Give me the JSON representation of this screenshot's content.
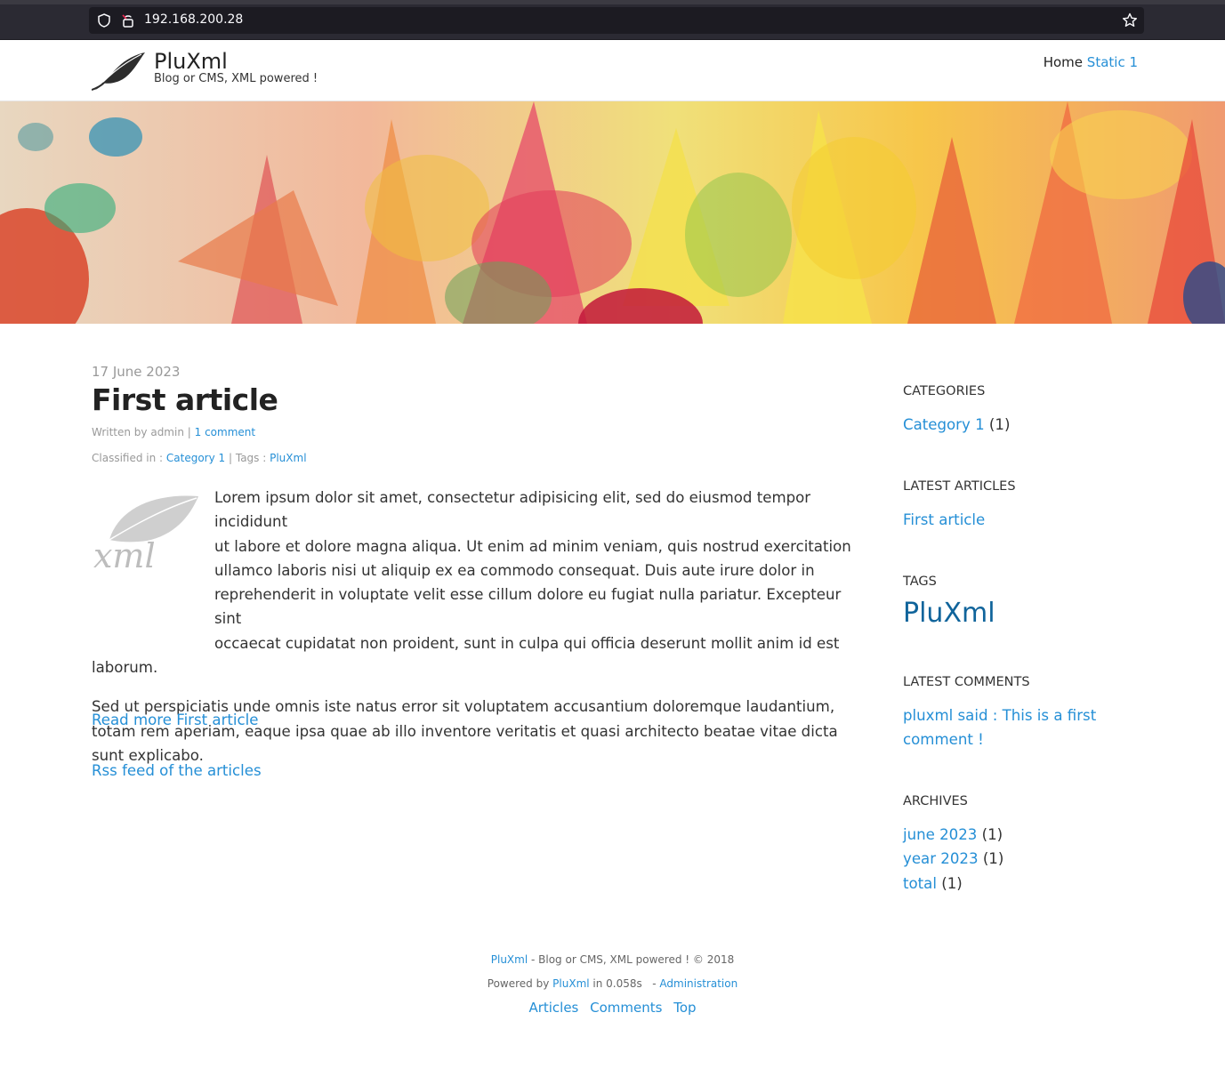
{
  "browser": {
    "url": "192.168.200.28"
  },
  "site": {
    "title": "PluXml",
    "description": "Blog or CMS, XML powered !"
  },
  "nav": {
    "home": "Home",
    "static1": "Static 1"
  },
  "article": {
    "date": "17 June 2023",
    "title": "First article",
    "written_by_prefix": "Written by admin |",
    "comments_link": "1 comment",
    "classified_prefix": "Classified in :",
    "category_link": "Category 1",
    "tags_prefix": "| Tags :",
    "tag_link": "PluXml",
    "paragraph1_line1": "Lorem ipsum dolor sit amet, consectetur adipisicing elit, sed do eiusmod tempor incididunt",
    "paragraph1_line2": "ut labore et dolore magna aliqua. Ut enim ad minim veniam, quis nostrud exercitation",
    "paragraph1_line3": "ullamco laboris nisi ut aliquip ex ea commodo consequat. Duis aute irure dolor in",
    "paragraph1_line4": "reprehenderit in voluptate velit esse cillum dolore eu fugiat nulla pariatur. Excepteur sint",
    "paragraph1_line5": "occaecat cupidatat non proident, sunt in culpa qui officia deserunt mollit anim id est",
    "paragraph1_line6": "laborum.",
    "paragraph2": "Sed ut perspiciatis unde omnis iste natus error sit voluptatem accusantium doloremque laudantium, totam rem aperiam, eaque ipsa quae ab illo inventore veritatis et quasi architecto beatae vitae dicta sunt explicabo.",
    "read_more": "Read more First article",
    "rss": "Rss feed of the articles"
  },
  "sidebar": {
    "categories_heading": "CATEGORIES",
    "category1": "Category 1",
    "category1_count": "(1)",
    "latest_articles_heading": "LATEST ARTICLES",
    "latest_article1": "First article",
    "tags_heading": "TAGS",
    "tag1": "PluXml",
    "latest_comments_heading": "LATEST COMMENTS",
    "comment1_line1": "pluxml said : This is a first",
    "comment1_line2": "comment !",
    "archives_heading": "ARCHIVES",
    "archive1": "june 2023",
    "archive1_count": "(1)",
    "archive2": "year 2023",
    "archive2_count": "(1)",
    "archive3": "total",
    "archive3_count": "(1)"
  },
  "footer": {
    "brand_link": "PluXml",
    "line1_rest": "- Blog or CMS, XML powered ! © 2018",
    "powered_prefix": "Powered by",
    "powered_link": "PluXml",
    "timing": "in 0.058s",
    "dash": "-",
    "admin_link": "Administration",
    "link_articles": "Articles",
    "link_comments": "Comments",
    "link_top": "Top"
  },
  "colors": {
    "link": "#258fd6",
    "tag": "#10649b",
    "browser_bg": "#2b2a33"
  }
}
